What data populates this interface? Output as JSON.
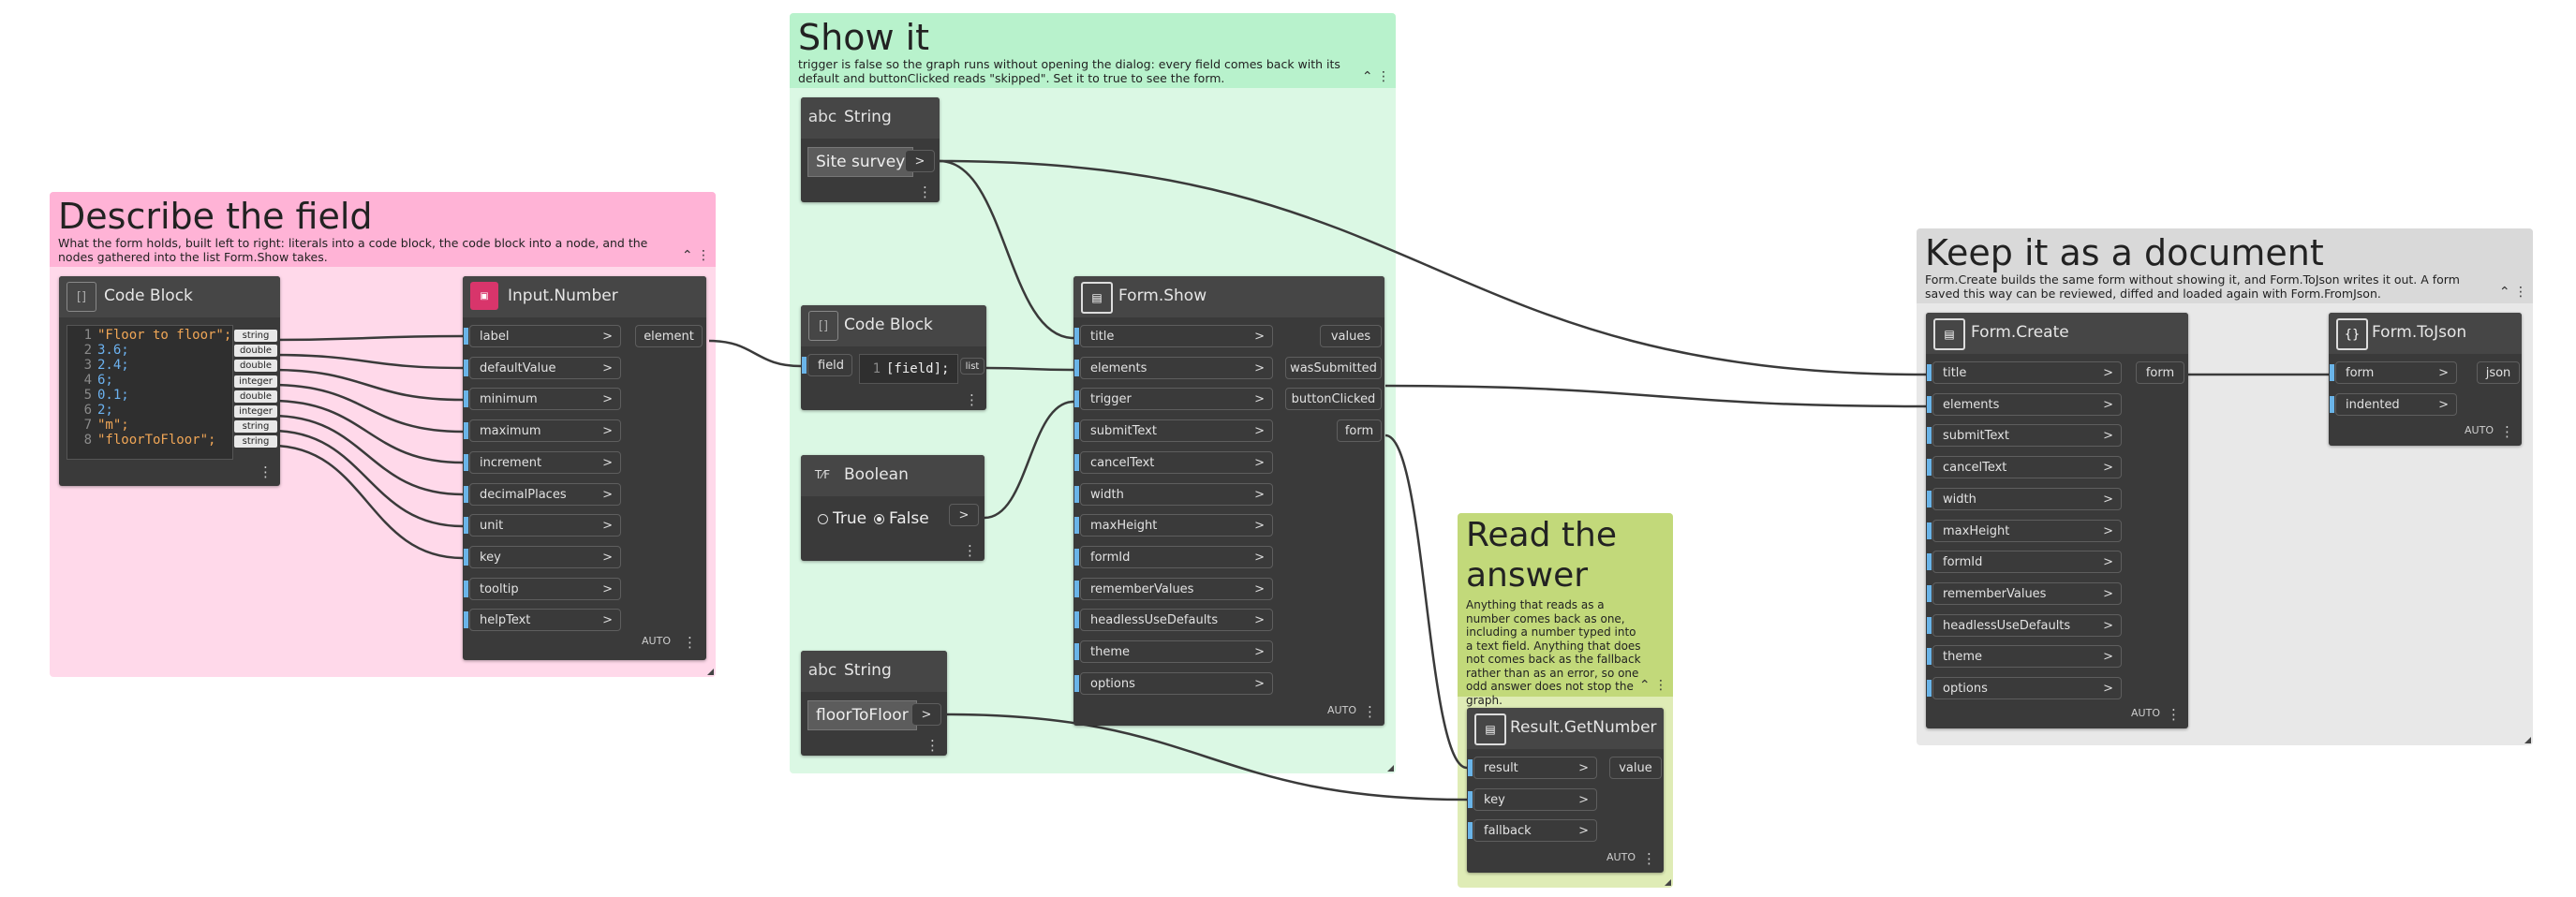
{
  "groups": {
    "describe": {
      "title": "Describe the field",
      "description": "What the form holds, built left to right: literals into a code block, the code block into a node, and the nodes gathered into the list Form.Show takes.",
      "color": "#ffb3d6",
      "body_color": "#ffd9ea"
    },
    "show": {
      "title": "Show it",
      "description": "trigger is false so the graph runs without opening the dialog: every field comes back with its default and buttonClicked reads \"skipped\". Set it to true to see the form.",
      "color": "#b8f2cc",
      "body_color": "#dbf8e4"
    },
    "read": {
      "title": "Read the answer",
      "description": "Anything that reads as a number comes back as one, including a number typed into a text field. Anything that does not comes back as the fallback rather than as an error, so one odd answer does not stop the graph.",
      "color": "#c2d97a",
      "body_color": "#dfecb6"
    },
    "keep": {
      "title": "Keep it as a document",
      "description": "Form.Create builds the same form without showing it, and Form.ToJson writes it out. A form saved this way can be reviewed, diffed and loaded again with Form.FromJson.",
      "color": "#d9d9d9",
      "body_color": "#e8e8e8"
    }
  },
  "nodes": {
    "code_block_1": {
      "title": "Code Block",
      "lines": [
        {
          "n": "1",
          "text": "\"Floor to floor\";",
          "kind": "str"
        },
        {
          "n": "2",
          "text": "3.6;",
          "kind": "num"
        },
        {
          "n": "3",
          "text": "2.4;",
          "kind": "num"
        },
        {
          "n": "4",
          "text": "6;",
          "kind": "num"
        },
        {
          "n": "5",
          "text": "0.1;",
          "kind": "num"
        },
        {
          "n": "6",
          "text": "2;",
          "kind": "num"
        },
        {
          "n": "7",
          "text": "\"m\";",
          "kind": "str"
        },
        {
          "n": "8",
          "text": "\"floorToFloor\";",
          "kind": "str"
        }
      ],
      "types": [
        "string",
        "double",
        "double",
        "integer",
        "double",
        "integer",
        "string",
        "string"
      ]
    },
    "input_number": {
      "title": "Input.Number",
      "inputs": [
        "label",
        "defaultValue",
        "minimum",
        "maximum",
        "increment",
        "decimalPlaces",
        "unit",
        "key",
        "tooltip",
        "helpText"
      ],
      "output": "element",
      "auto": "AUTO"
    },
    "string_1": {
      "title": "String",
      "value": "Site survey"
    },
    "code_block_2": {
      "title": "Code Block",
      "input": "field",
      "line_no": "1",
      "code": "[field];",
      "output": "list"
    },
    "boolean": {
      "title": "Boolean",
      "true_label": "True",
      "false_label": "False",
      "selected": "False"
    },
    "string_2": {
      "title": "String",
      "value": "floorToFloor"
    },
    "form_show": {
      "title": "Form.Show",
      "inputs": [
        "title",
        "elements",
        "trigger",
        "submitText",
        "cancelText",
        "width",
        "maxHeight",
        "formId",
        "rememberValues",
        "headlessUseDefaults",
        "theme",
        "options"
      ],
      "outputs": [
        "values",
        "wasSubmitted",
        "buttonClicked",
        "form"
      ],
      "auto": "AUTO"
    },
    "result_get_number": {
      "title": "Result.GetNumber",
      "inputs": [
        "result",
        "key",
        "fallback"
      ],
      "output": "value",
      "auto": "AUTO"
    },
    "form_create": {
      "title": "Form.Create",
      "inputs": [
        "title",
        "elements",
        "submitText",
        "cancelText",
        "width",
        "maxHeight",
        "formId",
        "rememberValues",
        "headlessUseDefaults",
        "theme",
        "options"
      ],
      "output": "form",
      "auto": "AUTO"
    },
    "form_to_json": {
      "title": "Form.ToJson",
      "inputs": [
        "form",
        "indented"
      ],
      "output": "json",
      "auto": "AUTO"
    }
  },
  "colors": {
    "wire": "#3a3a3a",
    "node_body": "#3a3a3a",
    "port_marker": "#6ab4e8"
  }
}
